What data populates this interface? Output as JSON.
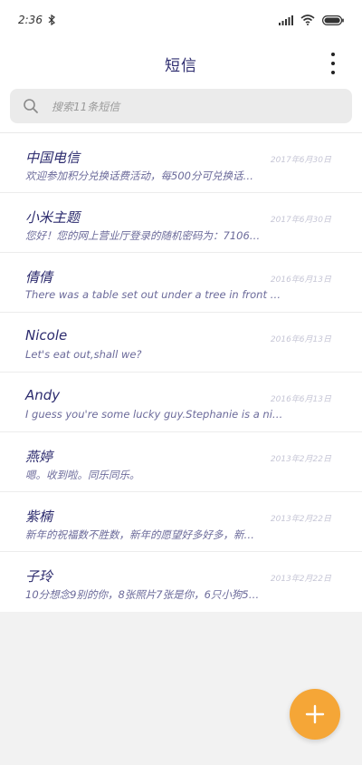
{
  "status_bar": {
    "time": "2:36",
    "icons": [
      "bluetooth-icon",
      "signal-icon",
      "wifi-icon",
      "battery-icon"
    ]
  },
  "header": {
    "title": "短信",
    "menu_icon": "more-vertical-icon"
  },
  "search": {
    "placeholder": "搜索11条短信",
    "icon": "search-icon"
  },
  "conversations": [
    {
      "name": "中国电信",
      "date": "2017年6月30日",
      "preview": "欢迎参加积分兑换话费活动，每500分可兑换话…"
    },
    {
      "name": "小米主题",
      "date": "2017年6月30日",
      "preview": "您好！您的网上营业厅登录的随机密码为：7106…"
    },
    {
      "name": "倩倩",
      "date": "2016年6月13日",
      "preview": "There was a table set out under a tree in front …"
    },
    {
      "name": "Nicole",
      "date": "2016年6月13日",
      "preview": "Let's eat out,shall we?"
    },
    {
      "name": "Andy",
      "date": "2016年6月13日",
      "preview": "I guess you're some lucky guy.Stephanie is a ni…"
    },
    {
      "name": "燕婷",
      "date": "2013年2月22日",
      "preview": "嗯。收到啦。同乐同乐。"
    },
    {
      "name": "紫楠",
      "date": "2013年2月22日",
      "preview": "新年的祝福数不胜数，新年的愿望好多好多，新…"
    },
    {
      "name": "子玲",
      "date": "2013年2月22日",
      "preview": "10分想念9别的你，8张照片7张是你，6只小狗5…"
    }
  ],
  "fab": {
    "icon": "plus-icon",
    "color": "#f5a637"
  },
  "colors": {
    "accent": "#f5a637",
    "name_text": "#2c2b6e",
    "preview_text": "#6b6a9a",
    "date_text": "#c6c6d6"
  }
}
